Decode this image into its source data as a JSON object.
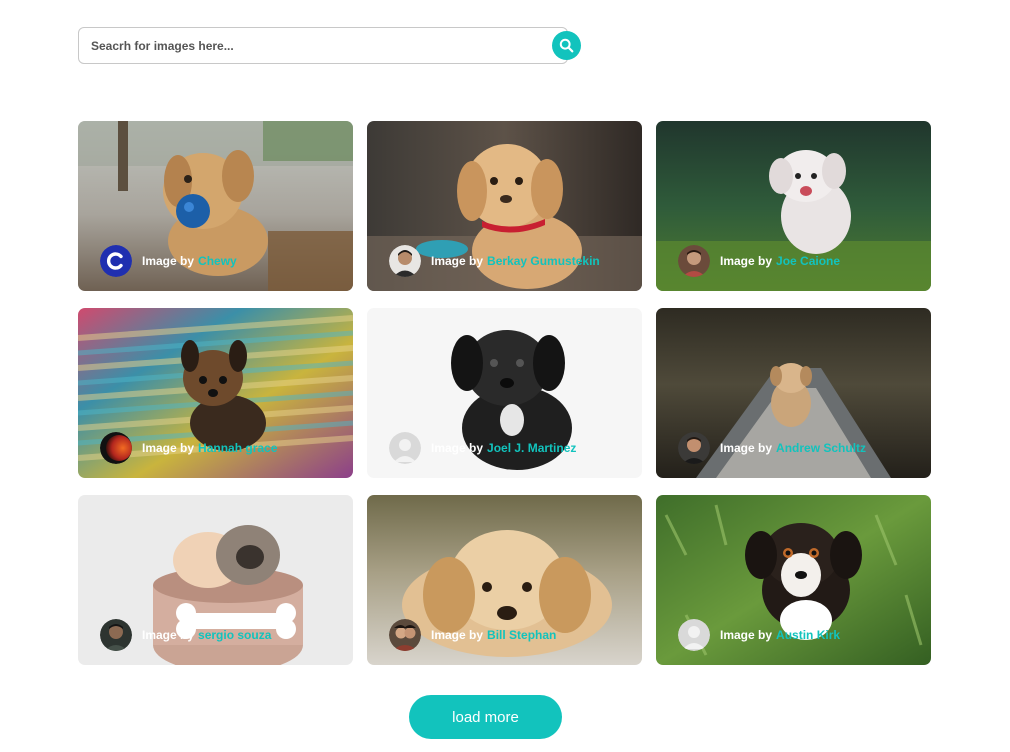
{
  "search": {
    "placeholder": "Seacrh for images here...",
    "value": "",
    "icon": "search-icon"
  },
  "accent": "#12c3bd",
  "cards": [
    {
      "label": "Image by",
      "author": "Chewy"
    },
    {
      "label": "Image by",
      "author": "Berkay Gumustekin"
    },
    {
      "label": "Image by",
      "author": "Joe Caione"
    },
    {
      "label": "Image by",
      "author": "Hannah grace"
    },
    {
      "label": "Image by",
      "author": "Joel J. Martinez"
    },
    {
      "label": "Image by",
      "author": "Andrew Schultz"
    },
    {
      "label": "Image by",
      "author": "sergio souza"
    },
    {
      "label": "Image by",
      "author": "Bill Stephan"
    },
    {
      "label": "Image by",
      "author": "Austin Kirk"
    }
  ],
  "load_more": {
    "label": "load more"
  }
}
